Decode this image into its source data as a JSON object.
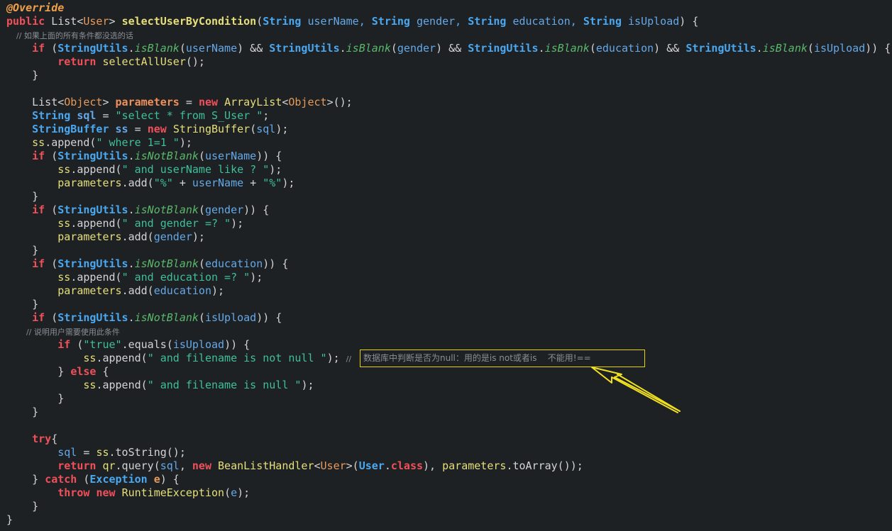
{
  "code_lines": [
    [
      {
        "t": "@Override",
        "c": "ann"
      }
    ],
    [
      {
        "t": "public ",
        "c": "kw bold"
      },
      {
        "t": "List",
        "c": "pl"
      },
      {
        "t": "<",
        "c": "pl"
      },
      {
        "t": "User",
        "c": "obj"
      },
      {
        "t": "> ",
        "c": "pl"
      },
      {
        "t": "selectUserByCondition",
        "c": "fn bold"
      },
      {
        "t": "(",
        "c": "pl"
      },
      {
        "t": "String ",
        "c": "type bold"
      },
      {
        "t": "userName, ",
        "c": "var"
      },
      {
        "t": "String ",
        "c": "type bold"
      },
      {
        "t": "gender, ",
        "c": "var"
      },
      {
        "t": "String ",
        "c": "type bold"
      },
      {
        "t": "education, ",
        "c": "var"
      },
      {
        "t": "String ",
        "c": "type bold"
      },
      {
        "t": "isUpload",
        "c": "var"
      },
      {
        "t": ") {",
        "c": "pl"
      }
    ],
    [
      {
        "t": "    // ",
        "c": "cm"
      },
      {
        "t": "如果上面的所有条件都没选的话",
        "c": "cm"
      }
    ],
    [
      {
        "t": "    if ",
        "c": "kw bold"
      },
      {
        "t": "(",
        "c": "pl"
      },
      {
        "t": "StringUtils",
        "c": "type bold"
      },
      {
        "t": ".",
        "c": "pl"
      },
      {
        "t": "isBlank",
        "c": "static"
      },
      {
        "t": "(",
        "c": "pl"
      },
      {
        "t": "userName",
        "c": "var"
      },
      {
        "t": ") && ",
        "c": "pl"
      },
      {
        "t": "StringUtils",
        "c": "type bold"
      },
      {
        "t": ".",
        "c": "pl"
      },
      {
        "t": "isBlank",
        "c": "static"
      },
      {
        "t": "(",
        "c": "pl"
      },
      {
        "t": "gender",
        "c": "var"
      },
      {
        "t": ") && ",
        "c": "pl"
      },
      {
        "t": "StringUtils",
        "c": "type bold"
      },
      {
        "t": ".",
        "c": "pl"
      },
      {
        "t": "isBlank",
        "c": "static"
      },
      {
        "t": "(",
        "c": "pl"
      },
      {
        "t": "education",
        "c": "var"
      },
      {
        "t": ") && ",
        "c": "pl"
      },
      {
        "t": "StringUtils",
        "c": "type bold"
      },
      {
        "t": ".",
        "c": "pl"
      },
      {
        "t": "isBlank",
        "c": "static"
      },
      {
        "t": "(",
        "c": "pl"
      },
      {
        "t": "isUpload",
        "c": "var"
      },
      {
        "t": ")) {",
        "c": "pl"
      }
    ],
    [
      {
        "t": "        return ",
        "c": "kw bold"
      },
      {
        "t": "selectAllUser",
        "c": "fn"
      },
      {
        "t": "();",
        "c": "pl"
      }
    ],
    [
      {
        "t": "    }",
        "c": "pl"
      }
    ],
    [
      {
        "t": "",
        "c": "pl"
      }
    ],
    [
      {
        "t": "    List",
        "c": "pl"
      },
      {
        "t": "<",
        "c": "pl"
      },
      {
        "t": "Object",
        "c": "obj"
      },
      {
        "t": "> ",
        "c": "pl"
      },
      {
        "t": "parameters ",
        "c": "fld"
      },
      {
        "t": "= ",
        "c": "pl"
      },
      {
        "t": "new ",
        "c": "kw bold"
      },
      {
        "t": "ArrayList",
        "c": "fn"
      },
      {
        "t": "<",
        "c": "pl"
      },
      {
        "t": "Object",
        "c": "obj"
      },
      {
        "t": ">();",
        "c": "pl"
      }
    ],
    [
      {
        "t": "    String ",
        "c": "type bold"
      },
      {
        "t": "sql ",
        "c": "var bold"
      },
      {
        "t": "= ",
        "c": "pl"
      },
      {
        "t": "\"select * from S_User \"",
        "c": "str"
      },
      {
        "t": ";",
        "c": "pl"
      }
    ],
    [
      {
        "t": "    StringBuffer ",
        "c": "type bold"
      },
      {
        "t": "ss ",
        "c": "var bold"
      },
      {
        "t": "= ",
        "c": "pl"
      },
      {
        "t": "new ",
        "c": "kw bold"
      },
      {
        "t": "StringBuffer",
        "c": "fn"
      },
      {
        "t": "(",
        "c": "pl"
      },
      {
        "t": "sql",
        "c": "var"
      },
      {
        "t": ");",
        "c": "pl"
      }
    ],
    [
      {
        "t": "    ss",
        "c": "fn"
      },
      {
        "t": ".append(",
        "c": "pl"
      },
      {
        "t": "\" where 1=1 \"",
        "c": "str"
      },
      {
        "t": ");",
        "c": "pl"
      }
    ],
    [
      {
        "t": "    if ",
        "c": "kw bold"
      },
      {
        "t": "(",
        "c": "pl"
      },
      {
        "t": "StringUtils",
        "c": "type bold"
      },
      {
        "t": ".",
        "c": "pl"
      },
      {
        "t": "isNotBlank",
        "c": "static"
      },
      {
        "t": "(",
        "c": "pl"
      },
      {
        "t": "userName",
        "c": "var"
      },
      {
        "t": ")) {",
        "c": "pl"
      }
    ],
    [
      {
        "t": "        ss",
        "c": "fn"
      },
      {
        "t": ".append(",
        "c": "pl"
      },
      {
        "t": "\" and userName like ? \"",
        "c": "str"
      },
      {
        "t": ");",
        "c": "pl"
      }
    ],
    [
      {
        "t": "        parameters",
        "c": "fn"
      },
      {
        "t": ".add(",
        "c": "pl"
      },
      {
        "t": "\"%\" ",
        "c": "str"
      },
      {
        "t": "+ ",
        "c": "pl"
      },
      {
        "t": "userName ",
        "c": "var"
      },
      {
        "t": "+ ",
        "c": "pl"
      },
      {
        "t": "\"%\"",
        "c": "str"
      },
      {
        "t": ");",
        "c": "pl"
      }
    ],
    [
      {
        "t": "    }",
        "c": "pl"
      }
    ],
    [
      {
        "t": "    if ",
        "c": "kw bold"
      },
      {
        "t": "(",
        "c": "pl"
      },
      {
        "t": "StringUtils",
        "c": "type bold"
      },
      {
        "t": ".",
        "c": "pl"
      },
      {
        "t": "isNotBlank",
        "c": "static"
      },
      {
        "t": "(",
        "c": "pl"
      },
      {
        "t": "gender",
        "c": "var"
      },
      {
        "t": ")) {",
        "c": "pl"
      }
    ],
    [
      {
        "t": "        ss",
        "c": "fn"
      },
      {
        "t": ".append(",
        "c": "pl"
      },
      {
        "t": "\" and gender =? \"",
        "c": "str"
      },
      {
        "t": ");",
        "c": "pl"
      }
    ],
    [
      {
        "t": "        parameters",
        "c": "fn"
      },
      {
        "t": ".add(",
        "c": "pl"
      },
      {
        "t": "gender",
        "c": "var"
      },
      {
        "t": ");",
        "c": "pl"
      }
    ],
    [
      {
        "t": "    }",
        "c": "pl"
      }
    ],
    [
      {
        "t": "    if ",
        "c": "kw bold"
      },
      {
        "t": "(",
        "c": "pl"
      },
      {
        "t": "StringUtils",
        "c": "type bold"
      },
      {
        "t": ".",
        "c": "pl"
      },
      {
        "t": "isNotBlank",
        "c": "static"
      },
      {
        "t": "(",
        "c": "pl"
      },
      {
        "t": "education",
        "c": "var"
      },
      {
        "t": ")) {",
        "c": "pl"
      }
    ],
    [
      {
        "t": "        ss",
        "c": "fn"
      },
      {
        "t": ".append(",
        "c": "pl"
      },
      {
        "t": "\" and education =? \"",
        "c": "str"
      },
      {
        "t": ");",
        "c": "pl"
      }
    ],
    [
      {
        "t": "        parameters",
        "c": "fn"
      },
      {
        "t": ".add(",
        "c": "pl"
      },
      {
        "t": "education",
        "c": "var"
      },
      {
        "t": ");",
        "c": "pl"
      }
    ],
    [
      {
        "t": "    }",
        "c": "pl"
      }
    ],
    [
      {
        "t": "    if ",
        "c": "kw bold"
      },
      {
        "t": "(",
        "c": "pl"
      },
      {
        "t": "StringUtils",
        "c": "type bold"
      },
      {
        "t": ".",
        "c": "pl"
      },
      {
        "t": "isNotBlank",
        "c": "static"
      },
      {
        "t": "(",
        "c": "pl"
      },
      {
        "t": "isUpload",
        "c": "var"
      },
      {
        "t": ")) {",
        "c": "pl"
      }
    ],
    [
      {
        "t": "        // ",
        "c": "cm"
      },
      {
        "t": "说明用户需要使用此条件",
        "c": "cm"
      }
    ],
    [
      {
        "t": "        if ",
        "c": "kw bold"
      },
      {
        "t": "(",
        "c": "pl"
      },
      {
        "t": "\"true\"",
        "c": "str"
      },
      {
        "t": ".equals(",
        "c": "pl"
      },
      {
        "t": "isUpload",
        "c": "var"
      },
      {
        "t": ")) {",
        "c": "pl"
      }
    ],
    [
      {
        "t": "            ss",
        "c": "fn"
      },
      {
        "t": ".append(",
        "c": "pl"
      },
      {
        "t": "\" and filename is not null \"",
        "c": "str"
      },
      {
        "t": "); ",
        "c": "pl"
      },
      {
        "t": "//",
        "c": "cm"
      }
    ],
    [
      {
        "t": "        } ",
        "c": "pl"
      },
      {
        "t": "else ",
        "c": "kw bold"
      },
      {
        "t": "{",
        "c": "pl"
      }
    ],
    [
      {
        "t": "            ss",
        "c": "fn"
      },
      {
        "t": ".append(",
        "c": "pl"
      },
      {
        "t": "\" and filename is null \"",
        "c": "str"
      },
      {
        "t": ");",
        "c": "pl"
      }
    ],
    [
      {
        "t": "        }",
        "c": "pl"
      }
    ],
    [
      {
        "t": "    }",
        "c": "pl"
      }
    ],
    [
      {
        "t": "",
        "c": "pl"
      }
    ],
    [
      {
        "t": "    try",
        "c": "kw bold"
      },
      {
        "t": "{",
        "c": "pl"
      }
    ],
    [
      {
        "t": "        sql ",
        "c": "var"
      },
      {
        "t": "= ",
        "c": "pl"
      },
      {
        "t": "ss",
        "c": "fn"
      },
      {
        "t": ".toString();",
        "c": "pl"
      }
    ],
    [
      {
        "t": "        return ",
        "c": "kw bold"
      },
      {
        "t": "qr",
        "c": "fn"
      },
      {
        "t": ".query(",
        "c": "pl"
      },
      {
        "t": "sql",
        "c": "var"
      },
      {
        "t": ", ",
        "c": "pl"
      },
      {
        "t": "new ",
        "c": "kw bold"
      },
      {
        "t": "BeanListHandler",
        "c": "fn"
      },
      {
        "t": "<",
        "c": "pl"
      },
      {
        "t": "User",
        "c": "obj"
      },
      {
        "t": ">(",
        "c": "pl"
      },
      {
        "t": "User",
        "c": "type bold"
      },
      {
        "t": ".",
        "c": "pl"
      },
      {
        "t": "class",
        "c": "kw bold"
      },
      {
        "t": "), ",
        "c": "pl"
      },
      {
        "t": "parameters",
        "c": "fn"
      },
      {
        "t": ".toArray());",
        "c": "pl"
      }
    ],
    [
      {
        "t": "    } ",
        "c": "pl"
      },
      {
        "t": "catch ",
        "c": "kw bold"
      },
      {
        "t": "(",
        "c": "pl"
      },
      {
        "t": "Exception ",
        "c": "type bold"
      },
      {
        "t": "e",
        "c": "obj bold"
      },
      {
        "t": ") {",
        "c": "pl"
      }
    ],
    [
      {
        "t": "        throw ",
        "c": "kw bold"
      },
      {
        "t": "new ",
        "c": "kw bold"
      },
      {
        "t": "RuntimeException",
        "c": "fn"
      },
      {
        "t": "(",
        "c": "pl"
      },
      {
        "t": "e",
        "c": "var"
      },
      {
        "t": ");",
        "c": "pl"
      }
    ],
    [
      {
        "t": "    }",
        "c": "pl"
      }
    ],
    [
      {
        "t": "}",
        "c": "pl"
      }
    ]
  ],
  "annotation": {
    "text": "数据库中判断是否为null：用的是is not或者is    不能用!=="
  },
  "colors": {
    "background": "#1e2124",
    "annotation_border": "#e6d200",
    "arrow": "#f0e020"
  }
}
